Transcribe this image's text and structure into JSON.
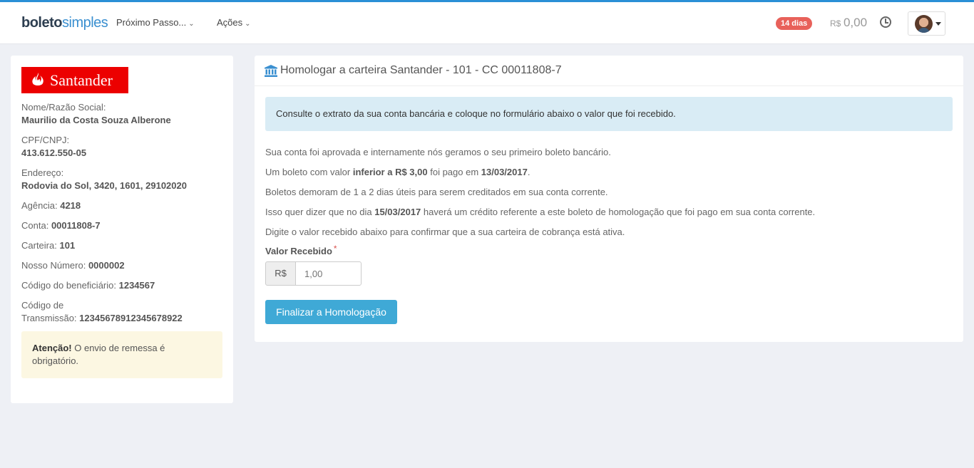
{
  "header": {
    "logo_part1": "boleto",
    "logo_part2": "simples",
    "nav": [
      {
        "label": "Próximo Passo..."
      },
      {
        "label": "Ações"
      }
    ],
    "trial_badge": "14 dias",
    "balance_currency": "R$",
    "balance_value": "0,00",
    "icons": {
      "history": "clock-icon",
      "user_menu": "chevron-down-icon"
    }
  },
  "sidebar": {
    "bank_name": "Santander",
    "bank_color": "#ec0000",
    "fields": [
      {
        "label": "Nome/Razão Social:",
        "value": "Maurilio da Costa Souza Alberone"
      },
      {
        "label": "CPF/CNPJ:",
        "value": "413.612.550-05"
      },
      {
        "label": "Endereço:",
        "value": "Rodovia do Sol, 3420, 1601, 29102020"
      },
      {
        "label": "Agência:",
        "value": "4218"
      },
      {
        "label": "Conta:",
        "value": "00011808-7"
      },
      {
        "label": "Carteira:",
        "value": "101"
      },
      {
        "label": "Nosso Número:",
        "value": "0000002"
      },
      {
        "label": "Código do beneficiário:",
        "value": "1234567"
      },
      {
        "label_line1": "Código de",
        "label_line2": "Transmissão:",
        "value": "12345678912345678922"
      }
    ],
    "warning": {
      "bold": "Atenção!",
      "text": " O envio de remessa é obrigatório."
    }
  },
  "main": {
    "title": "Homologar a carteira Santander - 101 - CC 00011808-7",
    "info": "Consulte o extrato da sua conta bancária e coloque no formulário abaixo o valor que foi recebido.",
    "p1": "Sua conta foi aprovada e internamente nós geramos o seu primeiro boleto bancário.",
    "p2": {
      "a": "Um boleto com valor ",
      "b": "inferior a R$ 3,00",
      "c": " foi pago em ",
      "d": "13/03/2017",
      "e": "."
    },
    "p3": "Boletos demoram de 1 a 2 dias úteis para serem creditados em sua conta corrente.",
    "p4": {
      "a": "Isso quer dizer que no dia ",
      "b": "15/03/2017",
      "c": " haverá um crédito referente a este boleto de homologação que foi pago em sua conta corrente."
    },
    "p5": "Digite o valor recebido abaixo para confirmar que a sua carteira de cobrança está ativa.",
    "form": {
      "label": "Valor Recebido",
      "required_mark": "*",
      "addon": "R$",
      "placeholder": "1,00",
      "submit": "Finalizar a Homologação"
    }
  },
  "colors": {
    "accent": "#3fa9d6",
    "badge": "#e8615a",
    "info_bg": "#d9ecf5",
    "warn_bg": "#fcf7e2"
  }
}
